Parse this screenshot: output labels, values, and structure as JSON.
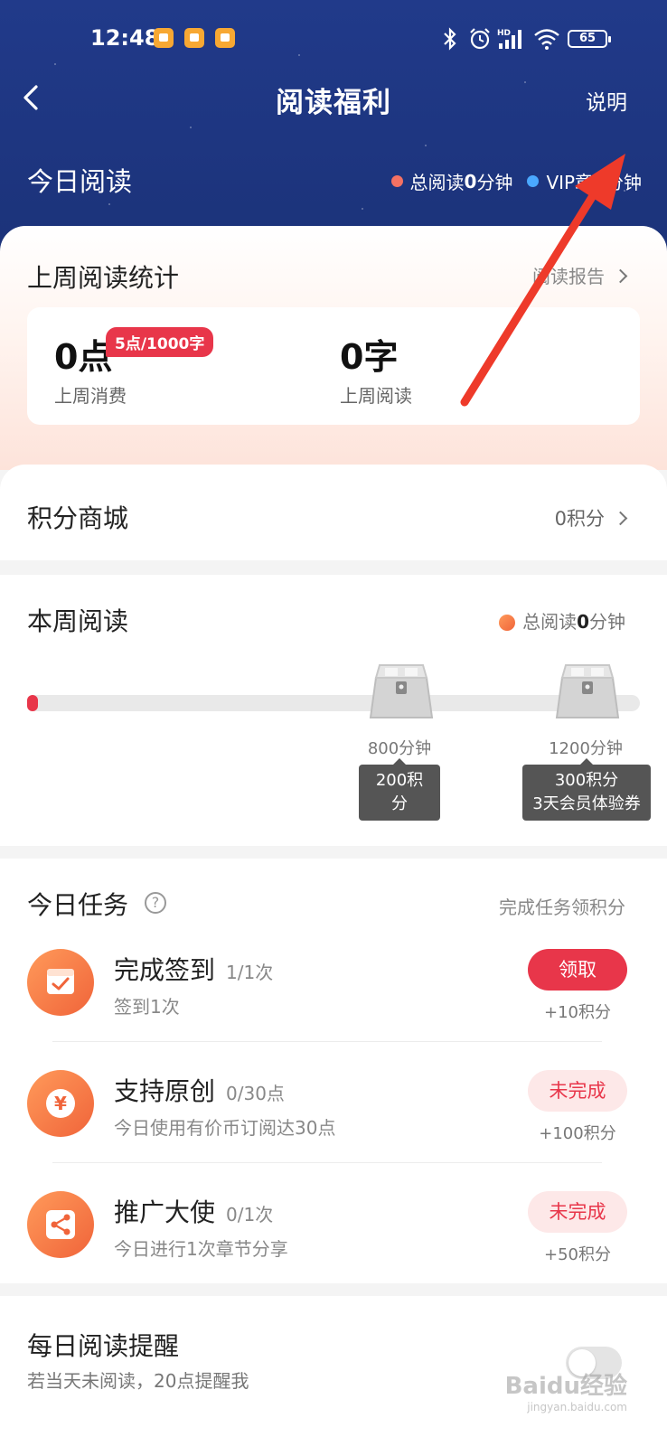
{
  "status_bar": {
    "time": "12:48",
    "battery": "65",
    "network": "HD",
    "notification_icons": [
      "message-icon",
      "message-icon",
      "message-icon"
    ],
    "system_icons": [
      "bluetooth-icon",
      "alarm-icon",
      "signal-icon",
      "wifi-icon",
      "battery-icon"
    ]
  },
  "header": {
    "title": "阅读福利",
    "explain_label": "说明"
  },
  "today": {
    "title": "今日阅读",
    "total_read_prefix": "总阅读",
    "total_read_value": "0",
    "total_read_unit": "分钟",
    "vip_prefix": "VIP章",
    "vip_value": "0",
    "vip_unit": "分钟",
    "total_dot_color": "#f47163",
    "vip_dot_color": "#4aa8ff"
  },
  "last_week": {
    "title": "上周阅读统计",
    "report_link": "阅读报告",
    "consumption_value": "0点",
    "consumption_label": "上周消费",
    "rate_badge": "5点/1000字",
    "read_value": "0字",
    "read_label": "上周阅读"
  },
  "mall": {
    "title": "积分商城",
    "points": "0积分"
  },
  "this_week": {
    "title": "本周阅读",
    "total_prefix": "总阅读",
    "total_value": "0",
    "total_unit": "分钟",
    "progress": 0.0,
    "milestones": [
      {
        "minutes": "800分钟",
        "reward": "200积分",
        "reward_extra": ""
      },
      {
        "minutes": "1200分钟",
        "reward": "300积分",
        "reward_extra": "3天会员体验券"
      }
    ]
  },
  "tasks": {
    "title": "今日任务",
    "hint": "完成任务领积分",
    "items": [
      {
        "name": "完成签到",
        "progress": "1/1次",
        "desc": "签到1次",
        "button": "领取",
        "reward": "+10积分",
        "status": "claimable",
        "icon": "calendar-check-icon"
      },
      {
        "name": "支持原创",
        "progress": "0/30点",
        "desc": "今日使用有价币订阅达30点",
        "button": "未完成",
        "reward": "+100积分",
        "status": "incomplete",
        "icon": "yuan-coin-icon"
      },
      {
        "name": "推广大使",
        "progress": "0/1次",
        "desc": "今日进行1次章节分享",
        "button": "未完成",
        "reward": "+50积分",
        "status": "incomplete",
        "icon": "share-icon"
      }
    ]
  },
  "reminder": {
    "title": "每日阅读提醒",
    "desc": "若当天未阅读，20点提醒我",
    "enabled": false
  },
  "watermark": {
    "text": "Baidu经验",
    "url": "jingyan.baidu.com"
  },
  "colors": {
    "header_bg": "#1e3682",
    "accent_red": "#e8364a",
    "annotation_arrow": "#ee3a2a"
  }
}
